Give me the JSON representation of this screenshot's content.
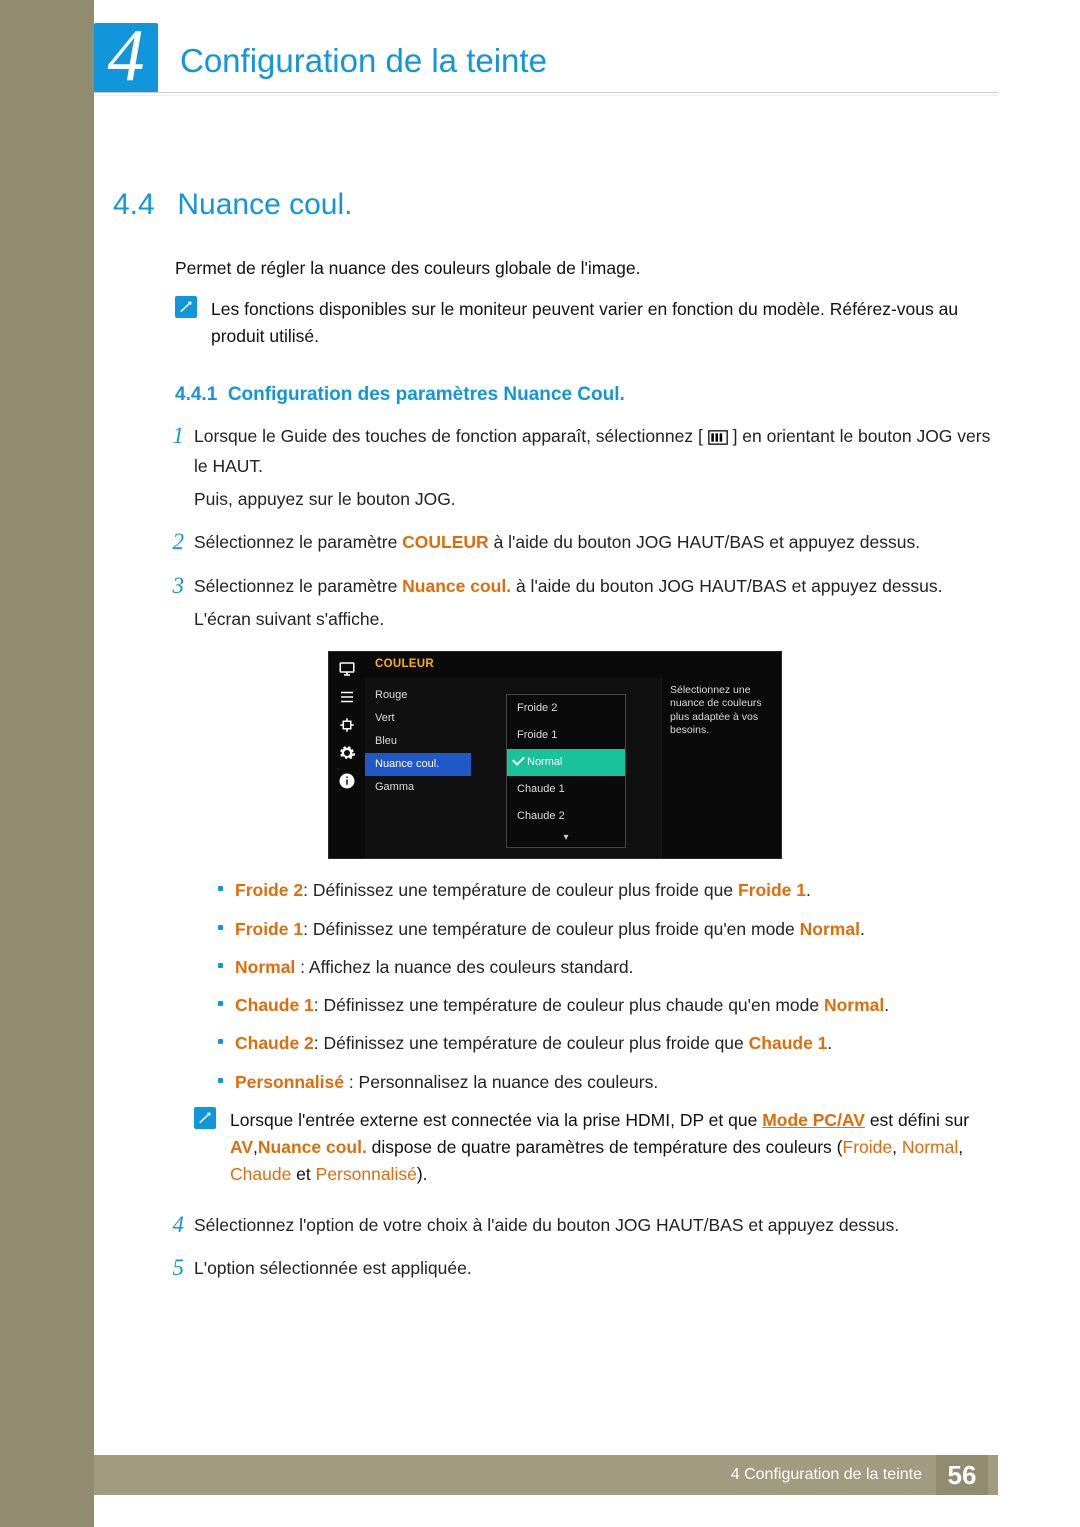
{
  "chapter": {
    "number": "4",
    "title": "Configuration de la teinte"
  },
  "section": {
    "number": "4.4",
    "title": "Nuance coul."
  },
  "intro": "Permet de régler la nuance des couleurs globale de l'image.",
  "note1": "Les fonctions disponibles sur le moniteur peuvent varier en fonction du modèle. Référez-vous au produit utilisé.",
  "subsection": {
    "number": "4.4.1",
    "title": "Configuration des paramètres Nuance Coul."
  },
  "steps": {
    "s1a": "Lorsque le Guide des touches de fonction apparaît, sélectionnez [",
    "s1b": "] en orientant le bouton JOG vers le HAUT.",
    "s1c": "Puis, appuyez sur le bouton JOG.",
    "s2a": "Sélectionnez le paramètre ",
    "s2_color": "COULEUR",
    "s2b": " à l'aide du bouton JOG HAUT/BAS et appuyez dessus.",
    "s3a": "Sélectionnez le paramètre ",
    "s3_item": "Nuance coul.",
    "s3b": " à l'aide du bouton JOG HAUT/BAS et appuyez dessus.",
    "s3c": "L'écran suivant s'affiche.",
    "s4": "Sélectionnez l'option de votre choix à l'aide du bouton JOG HAUT/BAS et appuyez dessus.",
    "s5": "L'option sélectionnée est appliquée.",
    "nums": {
      "n1": "1",
      "n2": "2",
      "n3": "3",
      "n4": "4",
      "n5": "5"
    }
  },
  "osd": {
    "title": "COULEUR",
    "items": [
      "Rouge",
      "Vert",
      "Bleu",
      "Nuance coul.",
      "Gamma"
    ],
    "submenu": [
      "Froide 2",
      "Froide 1",
      "Normal",
      "Chaude 1",
      "Chaude 2"
    ],
    "help": "Sélectionnez une nuance de couleurs plus adaptée à vos besoins."
  },
  "bullets": {
    "b1": {
      "term": "Froide 2",
      "sep": ": ",
      "text": "Définissez une température de couleur plus froide que ",
      "term2": "Froide 1",
      "tail": "."
    },
    "b2": {
      "term": "Froide 1",
      "sep": ": ",
      "text": "Définissez une température de couleur plus froide qu'en mode ",
      "term2": "Normal",
      "tail": "."
    },
    "b3": {
      "term": "Normal",
      "sep": " : ",
      "text": "Affichez la nuance des couleurs standard."
    },
    "b4": {
      "term": "Chaude 1",
      "sep": ": ",
      "text": "Définissez une température de couleur plus chaude qu'en mode ",
      "term2": "Normal",
      "tail": "."
    },
    "b5": {
      "term": "Chaude 2",
      "sep": ": ",
      "text": "Définissez une température de couleur plus froide que ",
      "term2": "Chaude 1",
      "tail": "."
    },
    "b6": {
      "term": "Personnalisé",
      "sep": " : ",
      "text": "Personnalisez la nuance des couleurs."
    }
  },
  "note2": {
    "a": "Lorsque l'entrée externe est connectée via la prise HDMI, DP et que ",
    "mode": "Mode PC/AV",
    "b": " est défini sur ",
    "av": "AV",
    "comma": ",",
    "nc": "Nuance coul.",
    "c": " dispose de quatre paramètres de température des couleurs (",
    "p1": "Froide",
    "s1": ", ",
    "p2": "Normal",
    "s2": ", ",
    "p3": "Chaude",
    "s3": " et ",
    "p4": "Personnalisé",
    "d": ")."
  },
  "footer": {
    "text": "4 Configuration de la teinte",
    "page": "56"
  }
}
